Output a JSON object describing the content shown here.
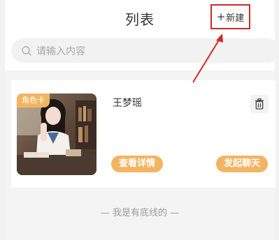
{
  "header": {
    "title": "列表",
    "new_button": {
      "plus": "+",
      "label": "新建"
    }
  },
  "search": {
    "icon": "search-icon",
    "placeholder": "请输入内容"
  },
  "list": {
    "items": [
      {
        "badge": "角色卡",
        "name": "王梦瑶",
        "delete_icon": "trash-icon",
        "detail_label": "查看详情",
        "chat_label": "发起聊天"
      }
    ]
  },
  "footer": {
    "end_text": "— 我是有底线的 —"
  },
  "colors": {
    "accent": "#f3b462",
    "annotation": "#cc2a2a",
    "page_bg": "#f4f4f4"
  }
}
